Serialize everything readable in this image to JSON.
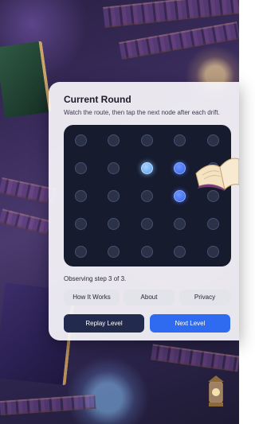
{
  "game": {
    "title": "Current Round",
    "instructions": "Watch the route, then tap the next node after each drift.",
    "status": "Observing step 3 of 3.",
    "grid": {
      "rows": 5,
      "cols": 5,
      "nodes": [
        {
          "row": 0,
          "col": 0,
          "state": "idle"
        },
        {
          "row": 0,
          "col": 1,
          "state": "idle"
        },
        {
          "row": 0,
          "col": 2,
          "state": "idle"
        },
        {
          "row": 0,
          "col": 3,
          "state": "idle"
        },
        {
          "row": 0,
          "col": 4,
          "state": "idle"
        },
        {
          "row": 1,
          "col": 0,
          "state": "idle"
        },
        {
          "row": 1,
          "col": 1,
          "state": "idle"
        },
        {
          "row": 1,
          "col": 2,
          "state": "active"
        },
        {
          "row": 1,
          "col": 3,
          "state": "selected"
        },
        {
          "row": 1,
          "col": 4,
          "state": "idle"
        },
        {
          "row": 2,
          "col": 0,
          "state": "idle"
        },
        {
          "row": 2,
          "col": 1,
          "state": "idle"
        },
        {
          "row": 2,
          "col": 2,
          "state": "idle"
        },
        {
          "row": 2,
          "col": 3,
          "state": "selected"
        },
        {
          "row": 2,
          "col": 4,
          "state": "idle"
        },
        {
          "row": 3,
          "col": 0,
          "state": "idle"
        },
        {
          "row": 3,
          "col": 1,
          "state": "idle"
        },
        {
          "row": 3,
          "col": 2,
          "state": "idle"
        },
        {
          "row": 3,
          "col": 3,
          "state": "idle"
        },
        {
          "row": 3,
          "col": 4,
          "state": "idle"
        },
        {
          "row": 4,
          "col": 0,
          "state": "idle"
        },
        {
          "row": 4,
          "col": 1,
          "state": "idle"
        },
        {
          "row": 4,
          "col": 2,
          "state": "idle"
        },
        {
          "row": 4,
          "col": 3,
          "state": "idle"
        },
        {
          "row": 4,
          "col": 4,
          "state": "idle"
        }
      ]
    }
  },
  "menu": {
    "how_it_works": "How It Works",
    "about": "About",
    "privacy": "Privacy"
  },
  "actions": {
    "replay_level": "Replay Level",
    "next_level": "Next Level"
  },
  "colors": {
    "board": "#161b2e",
    "active_node": "#7fb8f5",
    "selected_node": "#3562ea",
    "replay_button": "#222a4e",
    "next_button": "#2f6bf0"
  }
}
